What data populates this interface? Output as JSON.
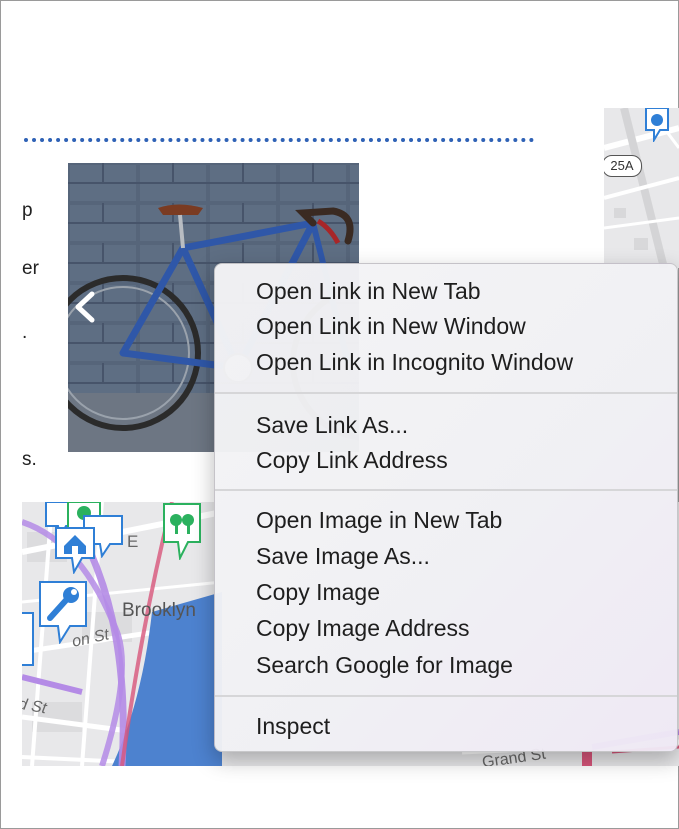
{
  "page": {
    "text_fragments": [
      "p",
      "er",
      ".",
      "s."
    ]
  },
  "photo": {
    "prev_icon": "chevron-left-icon"
  },
  "map": {
    "top": {
      "road_shield": "25A"
    },
    "bottom": {
      "neighborhood_label": "Brooklyn",
      "street_labels": [
        "on St",
        "d St",
        "Grand St"
      ],
      "letter_label": "E",
      "icons": [
        "wrench-icon",
        "house-icon",
        "tree-icon"
      ]
    },
    "colors": {
      "route_purple": "#b48be6",
      "route_pink": "#d7557a",
      "water": "#4d82cf",
      "marker_green": "#2bb15e",
      "marker_blue": "#2f7fd6"
    }
  },
  "context_menu": {
    "groups": [
      {
        "items": [
          "Open Link in New Tab",
          "Open Link in New Window",
          "Open Link in Incognito Window"
        ]
      },
      {
        "items": [
          "Save Link As...",
          "Copy Link Address"
        ]
      },
      {
        "items": [
          "Open Image in New Tab",
          "Save Image As...",
          "Copy Image",
          "Copy Image Address",
          "Search Google for Image"
        ]
      },
      {
        "items": [
          "Inspect"
        ]
      }
    ]
  }
}
